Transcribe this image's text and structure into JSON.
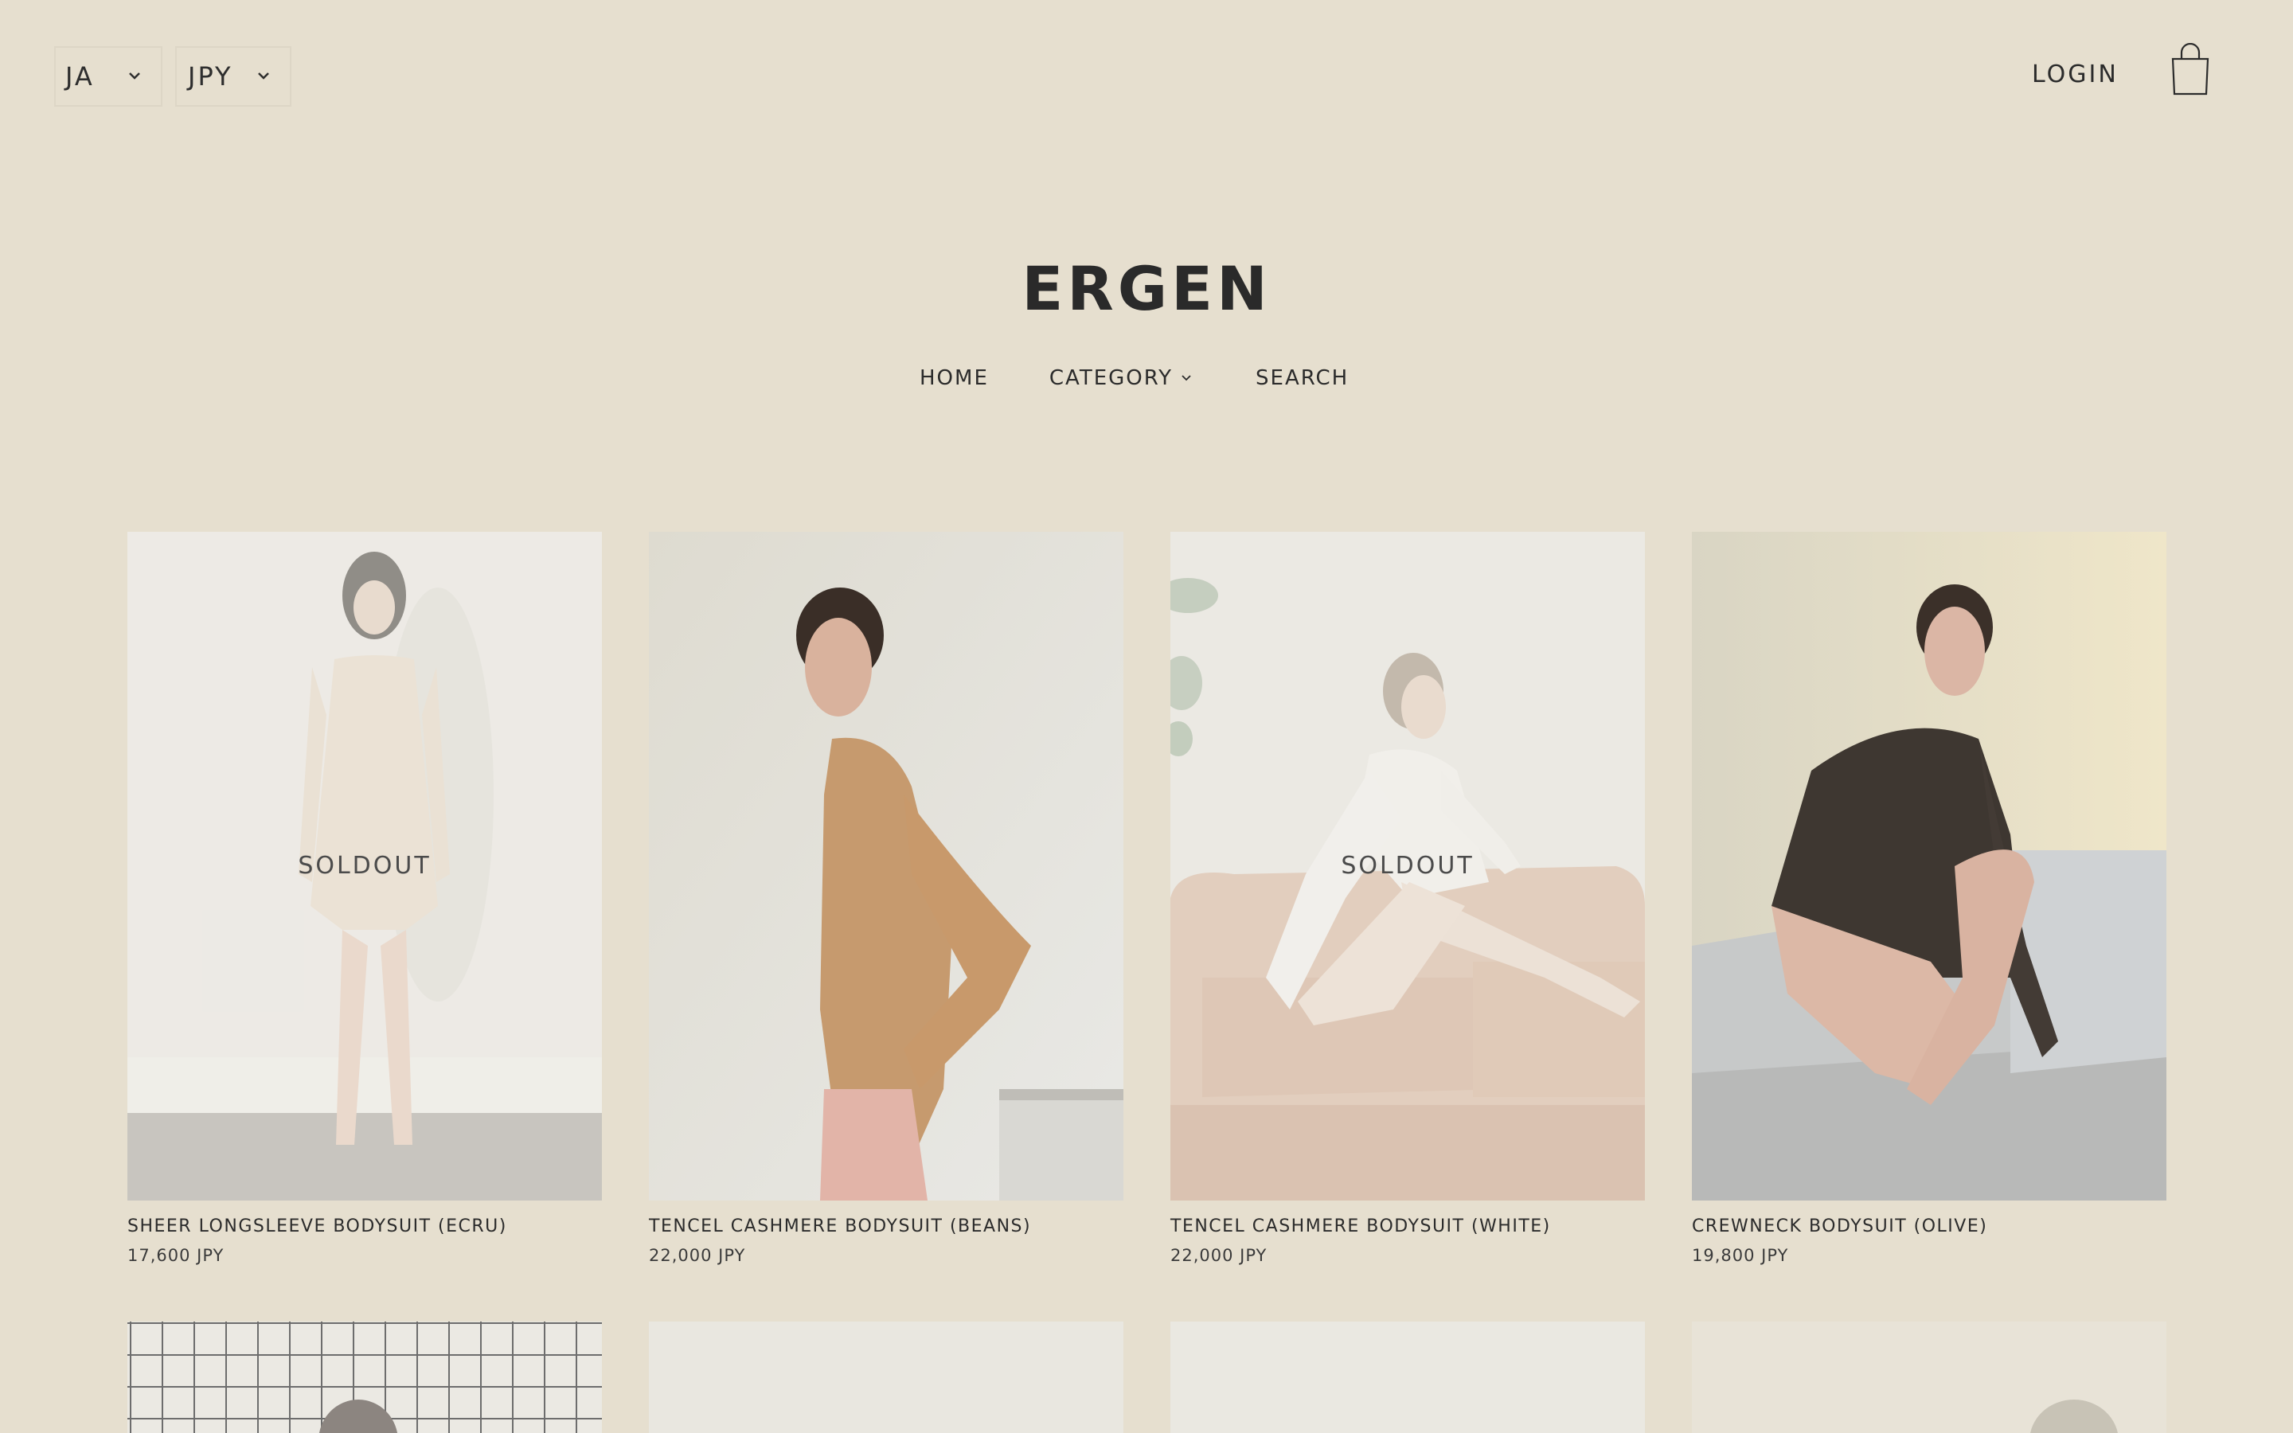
{
  "header": {
    "language": "JA",
    "currency": "JPY",
    "login_label": "LOGIN"
  },
  "brand": {
    "name": "ERGEN"
  },
  "nav": {
    "home": "HOME",
    "category": "CATEGORY",
    "search": "SEARCH"
  },
  "products": [
    {
      "name": "SHEER LONGSLEEVE BODYSUIT (ECRU)",
      "price": "17,600 JPY",
      "badge": "SOLDOUT"
    },
    {
      "name": "TENCEL CASHMERE BODYSUIT (BEANS)",
      "price": "22,000 JPY",
      "badge": ""
    },
    {
      "name": "TENCEL CASHMERE BODYSUIT (WHITE)",
      "price": "22,000 JPY",
      "badge": "SOLDOUT"
    },
    {
      "name": "CREWNECK BODYSUIT (OLIVE)",
      "price": "19,800 JPY",
      "badge": ""
    }
  ],
  "icons": {
    "language_chevron": "chevron-down-icon",
    "currency_chevron": "chevron-down-icon",
    "cart": "shopping-bag-icon",
    "category_chevron": "chevron-down-icon"
  },
  "colors": {
    "background": "#e6dfcf",
    "text": "#2b2b2b"
  }
}
